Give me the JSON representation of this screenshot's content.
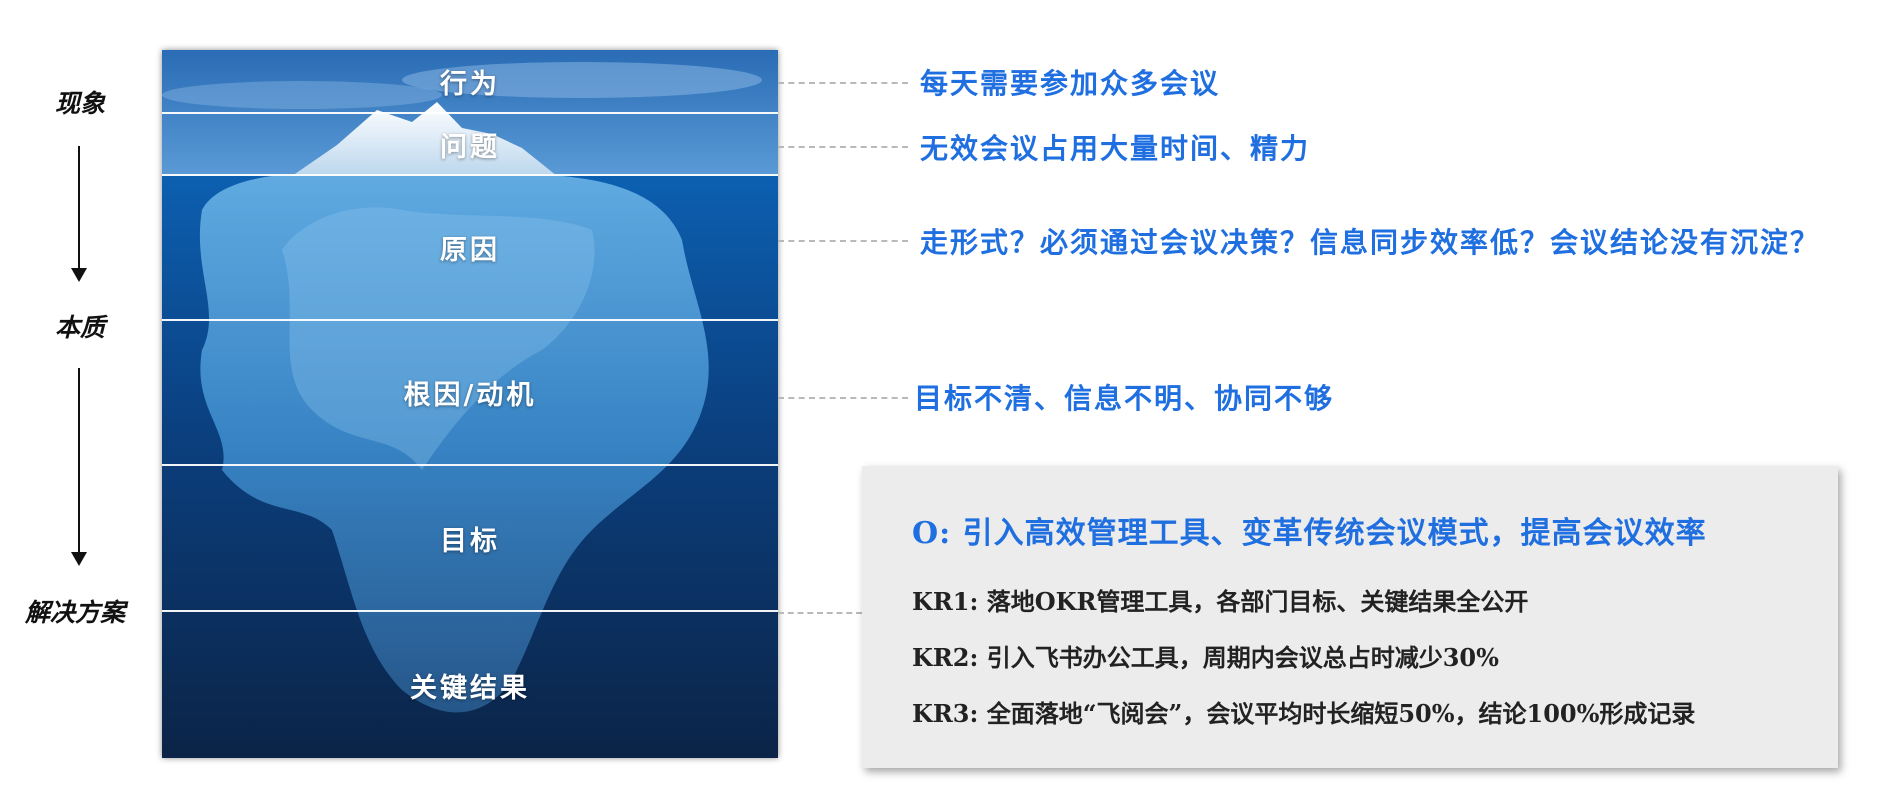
{
  "left_labels": {
    "phenomenon": "现象",
    "essence": "本质",
    "solution": "解决方案"
  },
  "bands": [
    {
      "label": "行为"
    },
    {
      "label": "问题"
    },
    {
      "label": "原因"
    },
    {
      "label": "根因/动机"
    },
    {
      "label": "目标"
    },
    {
      "label": "关键结果"
    }
  ],
  "annotations": {
    "behavior": "每天需要参加众多会议",
    "problem": "无效会议占用大量时间、精力",
    "cause": "走形式？必须通过会议决策？信息同步效率低？会议结论没有沉淀？",
    "root_cause": "目标不清、信息不明、协同不够"
  },
  "okr": {
    "objective": "O: 引入高效管理工具、变革传统会议模式，提高会议效率",
    "key_results": [
      "KR1: 落地OKR管理工具，各部门目标、关键结果全公开",
      "KR2: 引入飞书办公工具，周期内会议总占时减少30%",
      "KR3: 全面落地“飞阅会”，会议平均时长缩短50%，结论100%形成记录"
    ]
  },
  "colors": {
    "annotation_blue": "#1f6fe0",
    "sky_top": "#1e5fa8",
    "deep_water": "#0b2447"
  }
}
